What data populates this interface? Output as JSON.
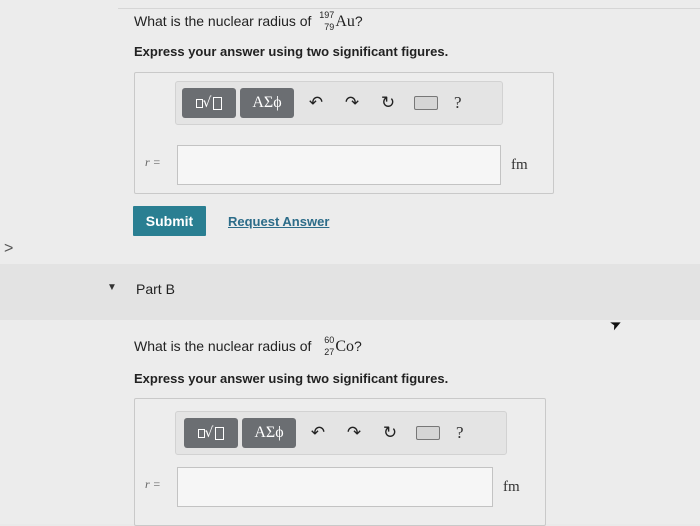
{
  "nav": {
    "left_chevron": ">"
  },
  "part_a": {
    "question_prefix": "What is the nuclear radius of",
    "isotope": {
      "mass": "197",
      "atomic": "79",
      "symbol": "Au"
    },
    "question_suffix": "?",
    "instruction": "Express your answer using two significant figures.",
    "toolbar": {
      "symbols_label": "ΑΣϕ",
      "undo": "↶",
      "redo": "↷",
      "reset": "↻",
      "help": "?"
    },
    "variable_label": "r =",
    "input_value": "",
    "unit": "fm"
  },
  "actions": {
    "submit_label": "Submit",
    "request_label": "Request Answer"
  },
  "part_b": {
    "caret": "▼",
    "title": "Part B",
    "question_prefix": "What is the nuclear radius of",
    "isotope": {
      "mass": "60",
      "atomic": "27",
      "symbol": "Co"
    },
    "question_suffix": "?",
    "instruction": "Express your answer using two significant figures.",
    "toolbar": {
      "symbols_label": "ΑΣϕ",
      "undo": "↶",
      "redo": "↷",
      "reset": "↻",
      "help": "?"
    },
    "variable_label": "r =",
    "input_value": "",
    "unit": "fm"
  },
  "colors": {
    "submit_bg": "#2a7f92",
    "link": "#2c6c89",
    "template_button": "#6b6e72"
  }
}
